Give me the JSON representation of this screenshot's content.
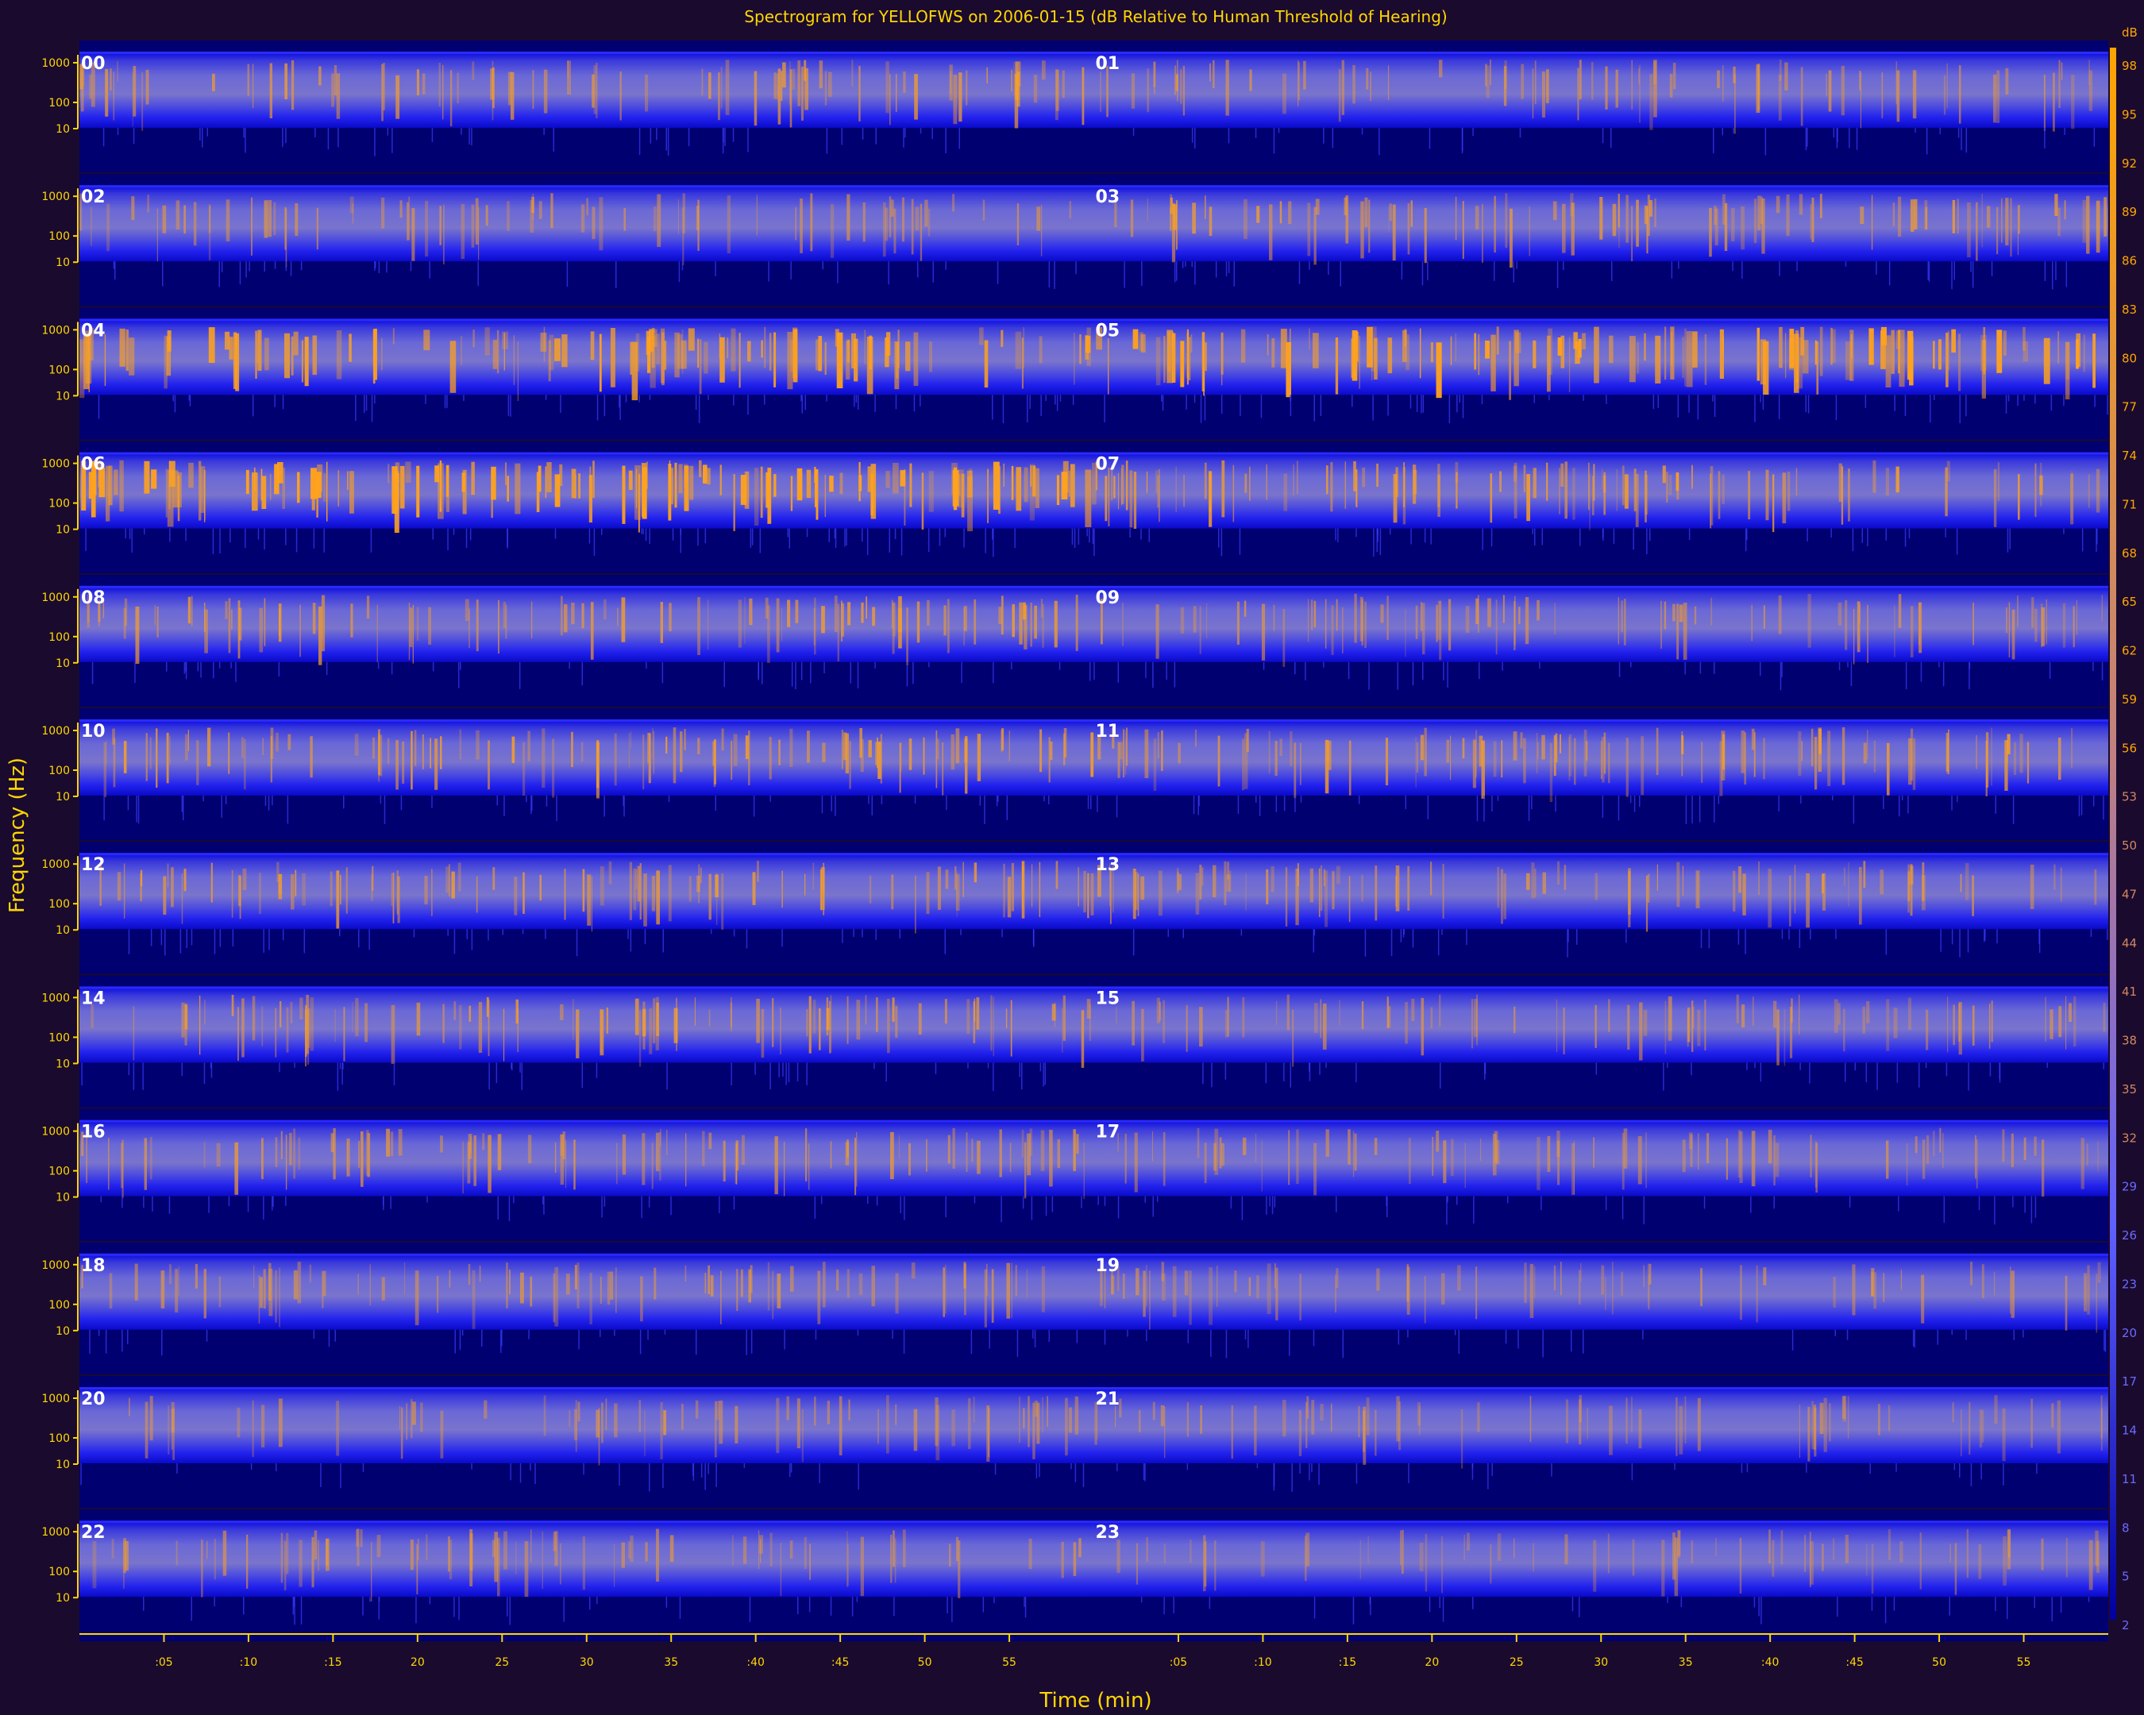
{
  "chart_data": {
    "type": "heatmap",
    "title": "Spectrogram for YELLOFWS on 2006-01-15 (dB Relative to Human Threshold of Hearing)",
    "xlabel": "Time (min)",
    "ylabel": "Frequency (Hz)",
    "colorbar_unit": "dB",
    "hours": [
      "00",
      "01",
      "02",
      "03",
      "04",
      "05",
      "06",
      "07",
      "08",
      "09",
      "10",
      "11",
      "12",
      "13",
      "14",
      "15",
      "16",
      "17",
      "18",
      "19",
      "20",
      "21",
      "22",
      "23"
    ],
    "freq_ticks": [
      "1000",
      "100",
      "10"
    ],
    "time_ticks_left": [
      ":05",
      ":10",
      ":15",
      "20",
      "25",
      "30",
      "35",
      ":40",
      ":45",
      "50",
      "55"
    ],
    "time_ticks_right": [
      ":05",
      ":10",
      ":15",
      "20",
      "25",
      "30",
      "35",
      ":40",
      ":45",
      "50",
      "55"
    ],
    "colorbar_ticks": [
      "98",
      "95",
      "92",
      "89",
      "86",
      "83",
      "80",
      "77",
      "74",
      "71",
      "68",
      "65",
      "62",
      "59",
      "56",
      "53",
      "50",
      "47",
      "44",
      "41",
      "38",
      "35",
      "32",
      "29",
      "26",
      "23",
      "20",
      "17",
      "14",
      "11",
      "8",
      "5",
      "2"
    ],
    "colorbar_range": [
      2,
      98
    ],
    "colors": {
      "background": "#1a0a2e",
      "low": "#000080",
      "mid": "#3a3aff",
      "high": "#ffa500",
      "text": "#ffd700"
    },
    "mean_intensity": [
      0.38,
      0.3,
      0.28,
      0.42,
      0.58,
      0.66,
      0.82,
      0.48,
      0.42,
      0.32,
      0.48,
      0.46,
      0.42,
      0.34,
      0.4,
      0.28,
      0.36,
      0.26,
      0.3,
      0.22,
      0.22,
      0.2,
      0.26,
      0.16
    ]
  }
}
